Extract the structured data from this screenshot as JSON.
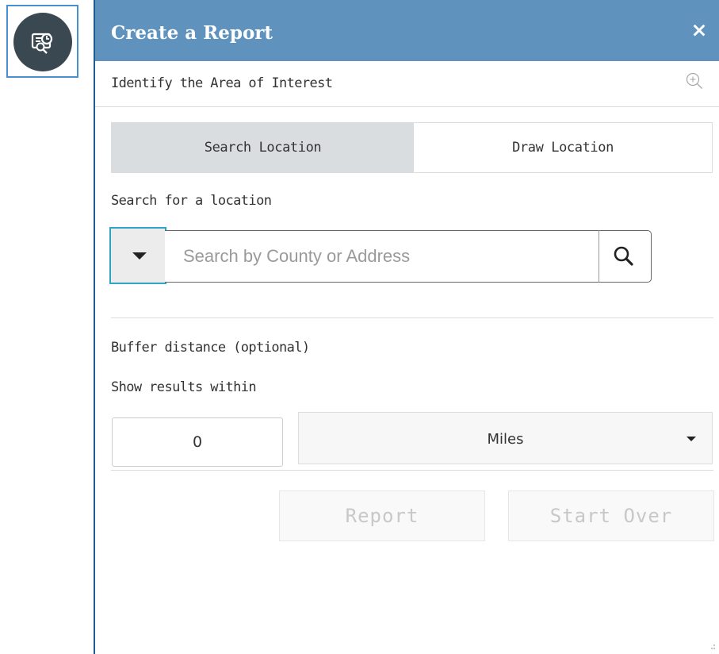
{
  "launcher": {
    "icon": "report-icon"
  },
  "panel": {
    "title": "Create a Report",
    "close_label": "×",
    "subheading": "Identify the Area of Interest",
    "zoom_icon": "zoom-in-icon"
  },
  "tabs": [
    {
      "label": "Search Location",
      "active": true
    },
    {
      "label": "Draw Location",
      "active": false
    }
  ],
  "search": {
    "label": "Search for a location",
    "placeholder": "Search by County or Address",
    "value": ""
  },
  "buffer": {
    "heading": "Buffer distance (optional)",
    "sublabel": "Show results within",
    "distance": "0",
    "unit": "Miles"
  },
  "actions": {
    "report_label": "Report",
    "start_over_label": "Start Over"
  },
  "colors": {
    "header": "#5f93bd",
    "panel_border": "#1f5a92",
    "focus_accent": "#2ea5c8",
    "active_tab": "#dadde0"
  }
}
